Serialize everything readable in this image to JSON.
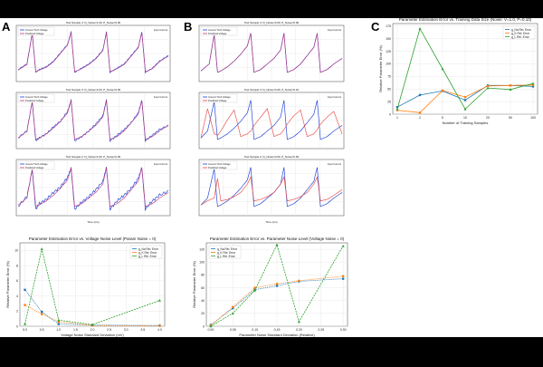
{
  "panel_labels": [
    "A",
    "B",
    "C"
  ],
  "colors": {
    "background_band": "#000000",
    "figure_bg": "#ffffff",
    "grid": "#e3e3e3",
    "blue": "#1f3fd6",
    "trace_red": "#e8453c",
    "predicted": "#c0397e",
    "mpl_blue": "#1f77b4",
    "mpl_orange": "#ff7f0e",
    "mpl_green": "#2ca02c"
  },
  "chart_data": [
    {
      "id": "A1",
      "type": "line",
      "title": "Test Sample 4: D_Noise=1.00, P_Noise=0.00",
      "legend": [
        "Ground Truth Voltage",
        "Predicted Voltage"
      ],
      "secondary_legend": "Input Current",
      "x": [
        0,
        5,
        8,
        10,
        12,
        16,
        20,
        24,
        28,
        30,
        32,
        36,
        40,
        44,
        48,
        50,
        52,
        56,
        60,
        64,
        68,
        70,
        72,
        76,
        80,
        85
      ],
      "series": [
        {
          "name": "Ground Truth Voltage",
          "values": [
            -0.4,
            -0.2,
            0.9,
            -0.5,
            -0.4,
            -0.3,
            -0.1,
            0.2,
            0.5,
            0.95,
            -0.5,
            -0.35,
            -0.2,
            0.0,
            0.3,
            0.95,
            -0.5,
            -0.35,
            -0.2,
            0.1,
            0.4,
            0.95,
            -0.5,
            -0.35,
            -0.1,
            0.1
          ]
        },
        {
          "name": "Predicted Voltage",
          "values": [
            -0.42,
            -0.22,
            0.88,
            -0.48,
            -0.42,
            -0.32,
            -0.12,
            0.18,
            0.48,
            0.93,
            -0.48,
            -0.37,
            -0.22,
            -0.02,
            0.28,
            0.93,
            -0.48,
            -0.37,
            -0.22,
            0.08,
            0.38,
            0.93,
            -0.48,
            -0.37,
            -0.12,
            0.08
          ]
        }
      ]
    },
    {
      "id": "A2",
      "type": "line",
      "title": "Test Sample 3: D_Noise=2.00, P_Noise=0.00",
      "legend": [
        "Ground Truth Voltage",
        "Predicted Voltage"
      ],
      "secondary_legend": "Input Current",
      "x": [
        0,
        5,
        8,
        10,
        12,
        16,
        20,
        24,
        28,
        30,
        32,
        36,
        40,
        44,
        48,
        50,
        52,
        56,
        60,
        64,
        68,
        70,
        72,
        76,
        80,
        85
      ],
      "series": [
        {
          "name": "Ground Truth Voltage",
          "values": [
            -0.45,
            -0.2,
            0.85,
            -0.55,
            -0.45,
            -0.3,
            -0.05,
            0.15,
            0.5,
            0.9,
            -0.55,
            -0.4,
            -0.2,
            0.05,
            0.35,
            0.92,
            -0.55,
            -0.35,
            -0.15,
            0.1,
            0.45,
            0.9,
            -0.55,
            -0.35,
            -0.15,
            0.0
          ]
        },
        {
          "name": "Predicted Voltage",
          "values": [
            -0.45,
            -0.2,
            0.85,
            -0.5,
            -0.45,
            -0.3,
            -0.1,
            0.15,
            0.45,
            0.9,
            -0.5,
            -0.4,
            -0.2,
            0.0,
            0.3,
            0.9,
            -0.5,
            -0.4,
            -0.2,
            0.1,
            0.4,
            0.9,
            -0.5,
            -0.4,
            -0.2,
            0.0
          ]
        }
      ]
    },
    {
      "id": "A3",
      "type": "line",
      "title": "Test Sample 2: D_Noise=4.00, P_Noise=0.00",
      "legend": [
        "Ground Truth Voltage",
        "Predicted Voltage"
      ],
      "secondary_legend": "Input Current",
      "xlabel": "Time (ms)",
      "x": [
        0,
        5,
        8,
        10,
        12,
        16,
        20,
        24,
        28,
        30,
        32,
        36,
        40,
        44,
        48,
        50,
        52,
        56,
        60,
        64,
        68,
        70,
        72,
        76,
        80,
        85
      ],
      "series": [
        {
          "name": "Ground Truth Voltage",
          "values": [
            -0.5,
            -0.15,
            0.8,
            -0.6,
            -0.4,
            -0.25,
            0.0,
            0.2,
            0.55,
            0.85,
            -0.6,
            -0.35,
            -0.15,
            0.1,
            0.4,
            0.9,
            -0.6,
            -0.3,
            -0.1,
            0.15,
            0.5,
            0.88,
            -0.6,
            -0.3,
            -0.1,
            0.05
          ]
        },
        {
          "name": "Predicted Voltage",
          "values": [
            -0.45,
            -0.2,
            0.85,
            -0.5,
            -0.45,
            -0.3,
            -0.1,
            0.15,
            0.45,
            0.9,
            -0.5,
            -0.4,
            -0.2,
            0.0,
            0.3,
            0.9,
            -0.5,
            -0.4,
            -0.2,
            0.1,
            0.4,
            0.9,
            -0.5,
            -0.4,
            -0.2,
            0.0
          ]
        }
      ]
    },
    {
      "id": "A4",
      "type": "line",
      "title": "Parameter Estimation Error vs. Voltage Noise Level (Param Noise = 0)",
      "xlabel": "Voltage Noise Standard Deviation (mV)",
      "ylabel": "Relative Parameter Error (%)",
      "x": [
        0.0,
        0.5,
        1.0,
        2.0,
        4.0
      ],
      "xticks": [
        "0.0",
        "0.5",
        "1.0",
        "1.5",
        "2.0",
        "2.5",
        "3.0",
        "3.5",
        "4.0"
      ],
      "xlim": [
        -0.15,
        4.15
      ],
      "yticks": [
        "0",
        "2",
        "4",
        "6",
        "8",
        "10"
      ],
      "ylim": [
        0,
        11
      ],
      "series": [
        {
          "name": "g_Na Rel. Error",
          "values": [
            4.8,
            1.9,
            0.3,
            0.15,
            0.1
          ]
        },
        {
          "name": "g_K Rel. Error",
          "values": [
            2.8,
            1.6,
            0.6,
            0.1,
            0.05
          ]
        },
        {
          "name": "g_L Rel. Error",
          "values": [
            0.3,
            10.2,
            0.8,
            0.2,
            3.4
          ]
        }
      ]
    },
    {
      "id": "B1",
      "type": "line",
      "title": "Test Sample 4: D_Noise=0.00, P_Noise=0.00",
      "legend": [
        "Ground Truth Voltage",
        "Predicted Voltage"
      ],
      "secondary_legend": "Input Current",
      "x": [
        0,
        5,
        8,
        10,
        12,
        16,
        20,
        24,
        28,
        30,
        32,
        36,
        40,
        44,
        48,
        50,
        52,
        56,
        60,
        64,
        68,
        70,
        72,
        76,
        80,
        85
      ],
      "series": [
        {
          "name": "Ground Truth Voltage",
          "values": [
            -0.45,
            -0.2,
            0.85,
            -0.5,
            -0.45,
            -0.3,
            -0.1,
            0.15,
            0.45,
            0.9,
            -0.5,
            -0.4,
            -0.2,
            0.0,
            0.3,
            0.9,
            -0.5,
            -0.4,
            -0.2,
            0.1,
            0.4,
            0.9,
            -0.5,
            -0.4,
            -0.2,
            0.0
          ]
        },
        {
          "name": "Predicted Voltage",
          "values": [
            -0.45,
            -0.2,
            0.85,
            -0.5,
            -0.45,
            -0.3,
            -0.1,
            0.15,
            0.45,
            0.9,
            -0.5,
            -0.4,
            -0.2,
            0.0,
            0.3,
            0.9,
            -0.5,
            -0.4,
            -0.2,
            0.1,
            0.4,
            0.9,
            -0.5,
            -0.4,
            -0.2,
            0.0
          ]
        }
      ]
    },
    {
      "id": "B2",
      "type": "line",
      "title": "Test Sample 3: D_Noise=0.00, P_Noise=0.10",
      "legend": [
        "Ground Truth Voltage",
        "Predicted Voltage"
      ],
      "secondary_legend": "Input Current",
      "x": [
        0,
        4,
        8,
        10,
        12,
        16,
        20,
        24,
        28,
        30,
        32,
        36,
        40,
        44,
        48,
        50,
        52,
        56,
        60,
        64,
        68,
        70,
        72,
        76,
        80,
        85
      ],
      "series": [
        {
          "name": "Ground Truth Voltage",
          "values": [
            -0.45,
            -0.2,
            0.85,
            -0.5,
            -0.45,
            -0.3,
            -0.1,
            0.15,
            0.45,
            0.9,
            -0.5,
            -0.4,
            -0.2,
            0.0,
            0.3,
            0.9,
            -0.5,
            -0.4,
            -0.2,
            0.1,
            0.4,
            0.9,
            -0.5,
            -0.4,
            -0.2,
            0.0
          ]
        },
        {
          "name": "Predicted Voltage",
          "values": [
            -0.45,
            0.6,
            -0.3,
            -0.35,
            -0.2,
            0.2,
            0.55,
            -0.4,
            -0.3,
            -0.2,
            0.0,
            0.3,
            0.6,
            -0.4,
            -0.3,
            -0.15,
            0.05,
            0.35,
            0.55,
            -0.4,
            -0.3,
            -0.15,
            0.05,
            0.3,
            0.5,
            -0.3
          ]
        }
      ]
    },
    {
      "id": "B3",
      "type": "line",
      "title": "Test Sample 2: D_Noise=0.00, P_Noise=0.60",
      "legend": [
        "Ground Truth Voltage",
        "Predicted Voltage"
      ],
      "secondary_legend": "Input Current",
      "xlabel": "Time (ms)",
      "x": [
        0,
        4,
        8,
        10,
        12,
        16,
        20,
        24,
        28,
        30,
        32,
        36,
        40,
        44,
        48,
        50,
        52,
        56,
        60,
        64,
        68,
        70,
        72,
        76,
        80,
        85
      ],
      "series": [
        {
          "name": "Ground Truth Voltage",
          "values": [
            -0.45,
            -0.2,
            0.85,
            -0.5,
            -0.45,
            -0.3,
            -0.1,
            0.15,
            0.45,
            0.9,
            -0.5,
            -0.4,
            -0.2,
            0.0,
            0.3,
            0.9,
            -0.5,
            -0.4,
            -0.2,
            0.1,
            0.4,
            0.9,
            -0.5,
            -0.4,
            -0.2,
            0.0
          ]
        },
        {
          "name": "Predicted Voltage",
          "values": [
            -0.45,
            -0.3,
            -0.2,
            0.5,
            -0.3,
            -0.25,
            -0.15,
            0.0,
            0.3,
            0.55,
            -0.3,
            -0.25,
            -0.15,
            0.0,
            0.3,
            0.55,
            -0.3,
            -0.25,
            -0.15,
            0.0,
            0.3,
            0.55,
            -0.3,
            -0.25,
            -0.1,
            0.1
          ]
        }
      ]
    },
    {
      "id": "B4",
      "type": "line",
      "title": "Parameter Estimation Error vs. Parameter Noise Level (Voltage Noise = 0)",
      "xlabel": "Parameter Noise Standard Deviation (Relative)",
      "ylabel": "Relative Parameter Error (%)",
      "x": [
        0.0,
        0.05,
        0.1,
        0.15,
        0.2,
        0.3
      ],
      "xticks": [
        "0.00",
        "0.05",
        "0.10",
        "0.15",
        "0.20",
        "0.25",
        "0.30"
      ],
      "xlim": [
        -0.01,
        0.31
      ],
      "yticks": [
        "0",
        "20",
        "40",
        "60",
        "80",
        "100",
        "120"
      ],
      "ylim": [
        0,
        130
      ],
      "series": [
        {
          "name": "g_Na Rel. Error",
          "values": [
            2,
            28,
            57,
            63,
            70,
            74
          ]
        },
        {
          "name": "g_K Rel. Error",
          "values": [
            1,
            30,
            60,
            66,
            71,
            78
          ]
        },
        {
          "name": "g_L Rel. Error",
          "values": [
            0,
            20,
            56,
            127,
            7,
            125
          ]
        }
      ]
    },
    {
      "id": "C",
      "type": "line",
      "title": "Parameter Estimation Error vs. Training Data Size (Noise: V=1.0, P=0.10)",
      "xlabel": "Number of Training Samples",
      "ylabel": "Relative Parameter Error (%)",
      "x": [
        "1",
        "2",
        "5",
        "10",
        "20",
        "50",
        "100"
      ],
      "yticks": [
        "0",
        "25",
        "50",
        "75",
        "100",
        "125",
        "150",
        "175"
      ],
      "ylim": [
        0,
        180
      ],
      "series": [
        {
          "name": "g_Na Rel. Error",
          "values": [
            14,
            38,
            46,
            28,
            57,
            57,
            55
          ]
        },
        {
          "name": "g_K Rel. Error",
          "values": [
            8,
            3,
            47,
            34,
            56,
            57,
            58
          ]
        },
        {
          "name": "g_L Rel. Error",
          "values": [
            10,
            170,
            90,
            10,
            52,
            49,
            61
          ]
        }
      ]
    }
  ]
}
